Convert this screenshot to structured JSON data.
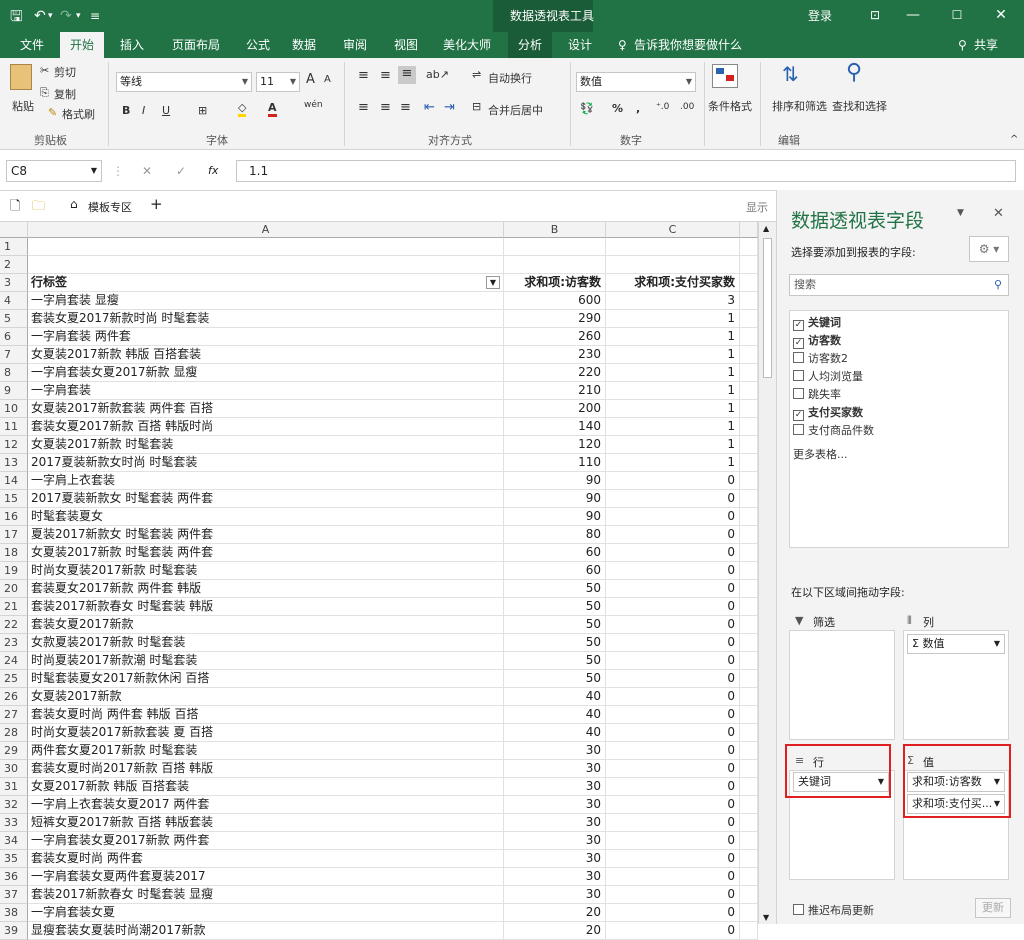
{
  "titlebar": {
    "context_title": "数据透视表工具",
    "login": "登录",
    "min": "—",
    "restore": "☐",
    "close": "✕",
    "layout_icon": "⊡"
  },
  "tabs": [
    "文件",
    "开始",
    "插入",
    "页面布局",
    "公式",
    "数据",
    "审阅",
    "视图",
    "美化大师",
    "分析",
    "设计"
  ],
  "tell_me": "告诉我你想要做什么",
  "share": "共享",
  "ribbon": {
    "clipboard": {
      "paste": "粘贴",
      "cut": "剪切",
      "copy": "复制",
      "format_painter": "格式刷",
      "label": "剪贴板"
    },
    "font": {
      "name": "等线",
      "size": "11",
      "label": "字体",
      "bold": "B",
      "italic": "I",
      "underline": "U",
      "grow": "A",
      "shrink": "A",
      "wen": "wén"
    },
    "alignment": {
      "wrap": "自动换行",
      "merge": "合并后居中",
      "label": "对齐方式"
    },
    "number": {
      "format": "数值",
      "percent": "%",
      "comma": ",",
      "inc": "⁺.0",
      "dec": ".00",
      "label": "数字"
    },
    "styles": {
      "conditional": "条件格式"
    },
    "editing": {
      "sort": "排序和筛选",
      "find": "查找和选择",
      "label": "编辑"
    }
  },
  "formula_bar": {
    "name_box": "C8",
    "cancel": "✕",
    "enter": "✓",
    "fx": "fx",
    "value": "1.1"
  },
  "sheet_tabs": {
    "template": "模板专区",
    "add": "+",
    "show": "显示"
  },
  "columns": [
    "A",
    "B",
    "C"
  ],
  "rows": [
    {
      "n": "1",
      "a": "",
      "b": "",
      "c": ""
    },
    {
      "n": "2",
      "a": "",
      "b": "",
      "c": ""
    },
    {
      "n": "3",
      "a": "行标签",
      "b": "求和项:访客数",
      "c": "求和项:支付买家数"
    },
    {
      "n": "4",
      "a": "一字肩套装 显瘦",
      "b": "600",
      "c": "3"
    },
    {
      "n": "5",
      "a": "套装女夏2017新款时尚 时髦套装",
      "b": "290",
      "c": "1"
    },
    {
      "n": "6",
      "a": "一字肩套装 两件套",
      "b": "260",
      "c": "1"
    },
    {
      "n": "7",
      "a": "女夏装2017新款 韩版 百搭套装",
      "b": "230",
      "c": "1"
    },
    {
      "n": "8",
      "a": "一字肩套装女夏2017新款 显瘦",
      "b": "220",
      "c": "1"
    },
    {
      "n": "9",
      "a": "一字肩套装",
      "b": "210",
      "c": "1"
    },
    {
      "n": "10",
      "a": "女夏装2017新款套装 两件套 百搭",
      "b": "200",
      "c": "1"
    },
    {
      "n": "11",
      "a": "套装女夏2017新款 百搭 韩版时尚",
      "b": "140",
      "c": "1"
    },
    {
      "n": "12",
      "a": "女夏装2017新款 时髦套装",
      "b": "120",
      "c": "1"
    },
    {
      "n": "13",
      "a": "2017夏装新款女时尚 时髦套装",
      "b": "110",
      "c": "1"
    },
    {
      "n": "14",
      "a": "一字肩上衣套装",
      "b": "90",
      "c": "0"
    },
    {
      "n": "15",
      "a": "2017夏装新款女 时髦套装 两件套",
      "b": "90",
      "c": "0"
    },
    {
      "n": "16",
      "a": "时髦套装夏女",
      "b": "90",
      "c": "0"
    },
    {
      "n": "17",
      "a": "夏装2017新款女 时髦套装 两件套",
      "b": "80",
      "c": "0"
    },
    {
      "n": "18",
      "a": "女夏装2017新款 时髦套装 两件套",
      "b": "60",
      "c": "0"
    },
    {
      "n": "19",
      "a": "时尚女夏装2017新款 时髦套装",
      "b": "60",
      "c": "0"
    },
    {
      "n": "20",
      "a": "套装夏女2017新款 两件套 韩版",
      "b": "50",
      "c": "0"
    },
    {
      "n": "21",
      "a": "套装2017新款春女 时髦套装 韩版",
      "b": "50",
      "c": "0"
    },
    {
      "n": "22",
      "a": "套装女夏2017新款",
      "b": "50",
      "c": "0"
    },
    {
      "n": "23",
      "a": "女款夏装2017新款 时髦套装",
      "b": "50",
      "c": "0"
    },
    {
      "n": "24",
      "a": "时尚夏装2017新款潮 时髦套装",
      "b": "50",
      "c": "0"
    },
    {
      "n": "25",
      "a": "时髦套装夏女2017新款休闲 百搭",
      "b": "50",
      "c": "0"
    },
    {
      "n": "26",
      "a": "女夏装2017新款",
      "b": "40",
      "c": "0"
    },
    {
      "n": "27",
      "a": "套装女夏时尚 两件套 韩版 百搭",
      "b": "40",
      "c": "0"
    },
    {
      "n": "28",
      "a": "时尚女夏装2017新款套装 夏 百搭",
      "b": "40",
      "c": "0"
    },
    {
      "n": "29",
      "a": "两件套女夏2017新款 时髦套装",
      "b": "30",
      "c": "0"
    },
    {
      "n": "30",
      "a": "套装女夏时尚2017新款 百搭 韩版",
      "b": "30",
      "c": "0"
    },
    {
      "n": "31",
      "a": "女夏2017新款 韩版 百搭套装",
      "b": "30",
      "c": "0"
    },
    {
      "n": "32",
      "a": "一字肩上衣套装女夏2017 两件套",
      "b": "30",
      "c": "0"
    },
    {
      "n": "33",
      "a": "短裤女夏2017新款 百搭 韩版套装",
      "b": "30",
      "c": "0"
    },
    {
      "n": "34",
      "a": "一字肩套装女夏2017新款 两件套",
      "b": "30",
      "c": "0"
    },
    {
      "n": "35",
      "a": "套装女夏时尚 两件套",
      "b": "30",
      "c": "0"
    },
    {
      "n": "36",
      "a": "一字肩套装女夏两件套夏装2017",
      "b": "30",
      "c": "0"
    },
    {
      "n": "37",
      "a": "套装2017新款春女 时髦套装 显瘦",
      "b": "30",
      "c": "0"
    },
    {
      "n": "38",
      "a": "一字肩套装女夏",
      "b": "20",
      "c": "0"
    },
    {
      "n": "39",
      "a": "显瘦套装女夏装时尚潮2017新款",
      "b": "20",
      "c": "0"
    }
  ],
  "pane": {
    "title": "数据透视表字段",
    "subtitle": "选择要添加到报表的字段:",
    "search_placeholder": "搜索",
    "fields": [
      {
        "label": "关键词",
        "checked": true
      },
      {
        "label": "访客数",
        "checked": true
      },
      {
        "label": "访客数2",
        "checked": false
      },
      {
        "label": "人均浏览量",
        "checked": false
      },
      {
        "label": "跳失率",
        "checked": false
      },
      {
        "label": "支付买家数",
        "checked": true
      },
      {
        "label": "支付商品件数",
        "checked": false
      }
    ],
    "more_tables": "更多表格...",
    "drag_label": "在以下区域间拖动字段:",
    "filter_label": "筛选",
    "columns_label": "列",
    "columns_item": "Σ 数值",
    "rows_label": "行",
    "rows_item": "关键词",
    "values_label": "值",
    "values_items": [
      "求和项:访客数",
      "求和项:支付买..."
    ],
    "defer": "推迟布局更新",
    "update": "更新"
  },
  "colors": {
    "accent": "#217346",
    "highlight": "#e02020"
  }
}
